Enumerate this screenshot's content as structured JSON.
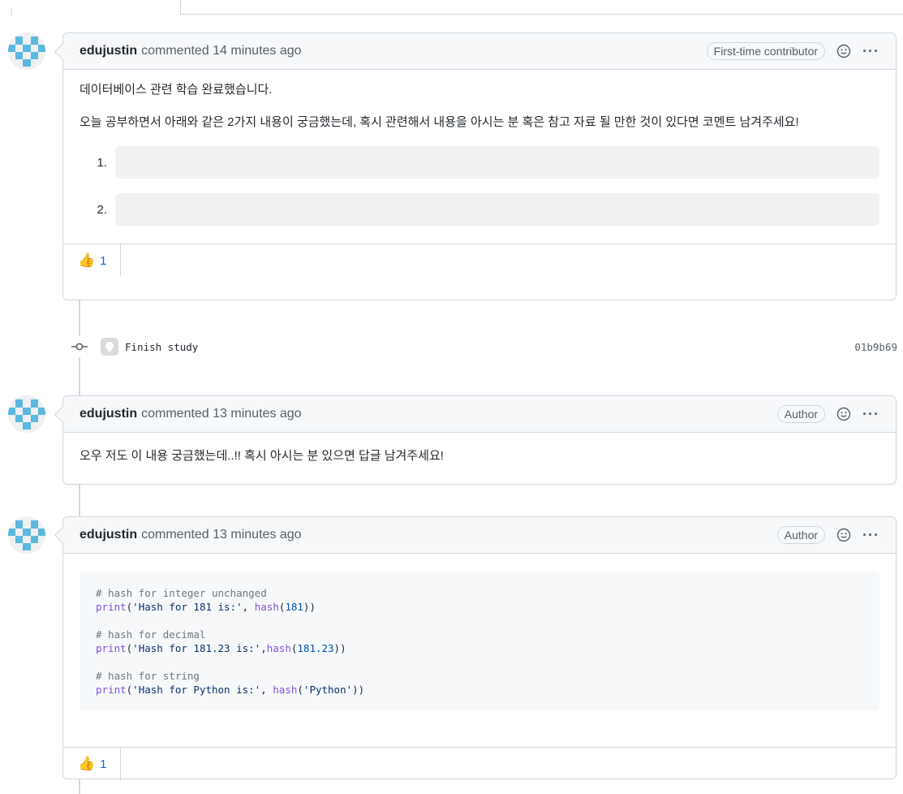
{
  "comments": [
    {
      "author": "edujustin",
      "meta": "commented 14 minutes ago",
      "badge": "First-time contributor",
      "paragraphs": [
        "데이터베이스 관련 학습 완료했습니다.",
        "오늘 공부하면서 아래와 같은 2가지 내용이 궁금했는데, 혹시 관련해서 내용을 아시는 분 혹은 참고 자료 될 만한 것이 있다면 코멘트 남겨주세요!"
      ],
      "list": [
        "1.",
        "2."
      ],
      "reaction": {
        "emoji": "👍",
        "count": "1"
      }
    },
    {
      "author": "edujustin",
      "meta": "commented 13 minutes ago",
      "badge": "Author",
      "paragraphs": [
        "오우 저도 이 내용 궁금했는데..!! 혹시 아시는 분 있으면 답글 남겨주세요!"
      ]
    },
    {
      "author": "edujustin",
      "meta": "commented 13 minutes ago",
      "badge": "Author",
      "code": {
        "c1": "# hash for integer unchanged",
        "c2": "# hash for decimal",
        "c3": "# hash for string",
        "print": "print",
        "hash": "hash",
        "s1": "'Hash for 181 is:'",
        "s2": "'Hash for 181.23 is:'",
        "s3": "'Hash for Python is:'",
        "s4": "'Python'",
        "n1": "181",
        "n2": "181.23"
      },
      "reaction": {
        "emoji": "👍",
        "count": "1"
      }
    }
  ],
  "commit": {
    "message": "Finish study",
    "sha": "01b9b69"
  },
  "icons": {
    "avatar": "identicon-avatar",
    "smiley": "smiley-icon",
    "kebab": "kebab-horizontal-icon",
    "commit": "git-commit-icon",
    "commit_avatar": "github-avatar-icon"
  },
  "colors": {
    "avatar_fill": "#5bb8dc",
    "link": "#0969da",
    "border": "#d0d7de",
    "header_bg": "#f6f8fa"
  },
  "menu_glyph": "···"
}
